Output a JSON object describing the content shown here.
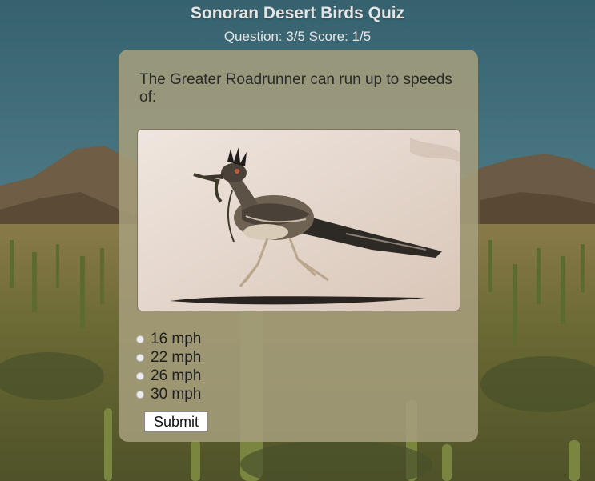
{
  "quiz": {
    "title": "Sonoran Desert Birds Quiz",
    "status": "Question: 3/5 Score: 1/5"
  },
  "question": {
    "text": "The Greater Roadrunner can run up to speeds of:",
    "options": [
      "16 mph",
      "22 mph",
      "26 mph",
      "30 mph"
    ],
    "submit_label": "Submit"
  }
}
